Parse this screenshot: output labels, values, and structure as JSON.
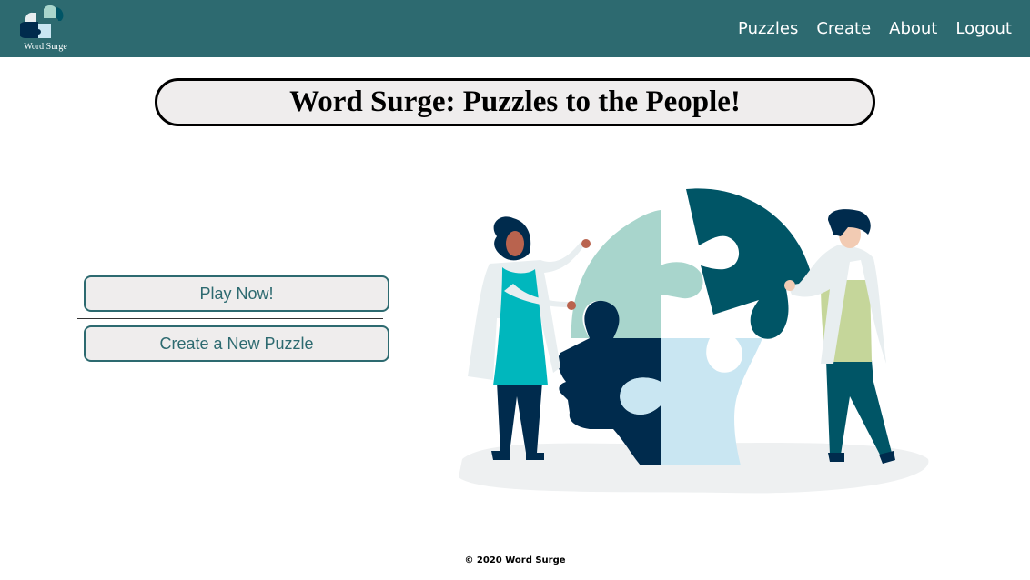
{
  "navbar": {
    "logo_text": "Word Surge",
    "links": [
      {
        "label": "Puzzles"
      },
      {
        "label": "Create"
      },
      {
        "label": "About"
      },
      {
        "label": "Logout"
      }
    ]
  },
  "main": {
    "title": "Word Surge: Puzzles to the People!",
    "play_button_label": "Play Now!",
    "create_button_label": "Create a New Puzzle"
  },
  "footer": {
    "copyright": "© 2020 Word Surge"
  },
  "colors": {
    "navbar_bg": "#2d6a70",
    "button_text": "#2d6a70",
    "button_bg": "#efeded",
    "puzzle_mint": "#a8d5cc",
    "puzzle_teal": "#005566",
    "puzzle_navy": "#002b4d",
    "puzzle_light_blue": "#c9e6f2"
  },
  "icons": {
    "logo": "puzzle-logo-icon",
    "illustration": "puzzle-head-illustration"
  }
}
